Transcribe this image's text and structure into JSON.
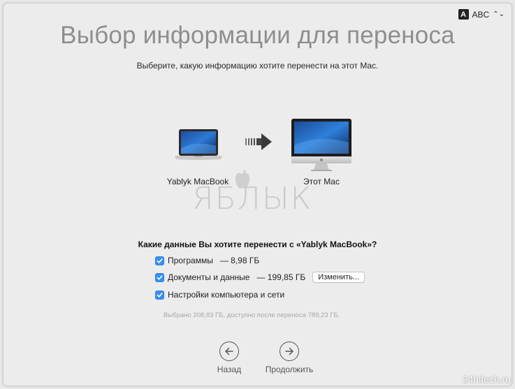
{
  "input_source": {
    "badge": "A",
    "label": "ABC",
    "arrows": "⌃⌄"
  },
  "title": "Выбор информации для переноса",
  "subtitle": "Выберите, какую информацию хотите перенести на этот Mac.",
  "source_device": {
    "label": "Yablyk MacBook",
    "icon": "laptop-icon"
  },
  "target_device": {
    "label": "Этот Mac",
    "icon": "imac-icon"
  },
  "transfer_arrow_icon": "arrow-right-icon",
  "watermark": {
    "text": "ЯБЛЫК",
    "icon": "apple-logo-icon"
  },
  "question": "Какие данные Вы хотите перенести с «Yablyk MacBook»?",
  "options": [
    {
      "label": "Программы",
      "size": "— 8,98 ГБ",
      "checked": true
    },
    {
      "label": "Документы и данные",
      "size": "— 199,85 ГБ",
      "checked": true,
      "button": "Изменить..."
    },
    {
      "label": "Настройки компьютера и сети",
      "checked": true
    }
  ],
  "summary": "Выбрано 208,83 ГБ, доступно после переноса 789,23 ГБ.",
  "nav": {
    "back": "Назад",
    "continue": "Продолжить"
  },
  "site_watermark": "24hitech.ru",
  "colors": {
    "accent": "#3a8ff0",
    "title": "#8e8e8e",
    "background": "#ececec"
  }
}
